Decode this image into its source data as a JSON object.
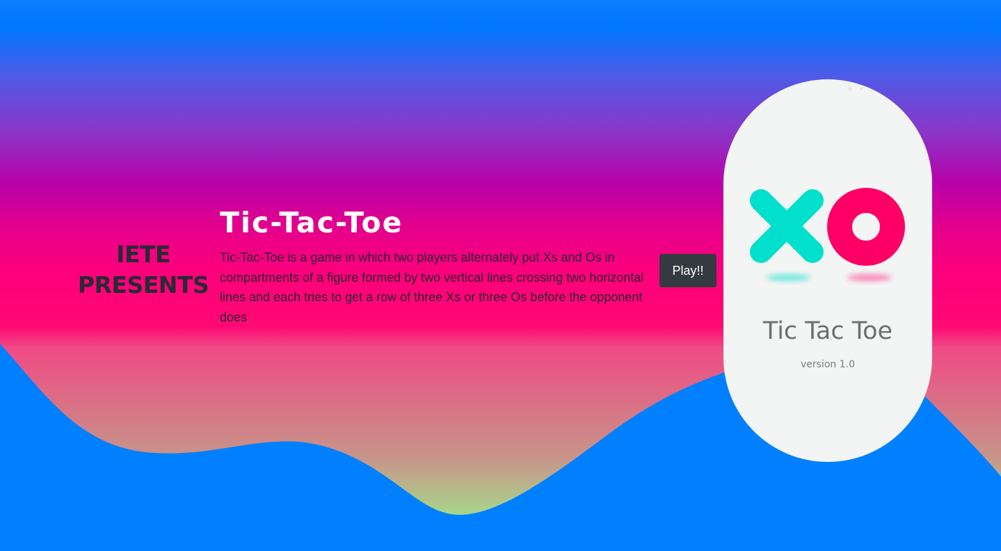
{
  "colors": {
    "top_bar": "#0077ff",
    "wave": "#0080ff",
    "gradient_stops": [
      "#0078ff",
      "#b900a8",
      "#ff007a",
      "#a8d68a"
    ],
    "button_bg": "#343a40",
    "x_mark": "#00e0cc",
    "o_mark": "#ff0066"
  },
  "hero": {
    "presents_line1": "IETE",
    "presents_line2": "PRESENTS",
    "title": "Tic-Tac-Toe",
    "description": "Tic-Tac-Toe is a game in which two players alternately put Xs and Os in compartments of a figure formed by two vertical lines crossing two horizontal lines and each tries to get a row of three Xs or three Os before the opponent does",
    "play_label": "Play!!"
  },
  "phone": {
    "status_left": "◐ ◒",
    "status_right": "◉ ▾ ◢ ▮",
    "logo_icons": [
      "x-mark-icon",
      "o-mark-icon"
    ],
    "app_name": "Tic Tac Toe",
    "version": "version 1.0"
  }
}
